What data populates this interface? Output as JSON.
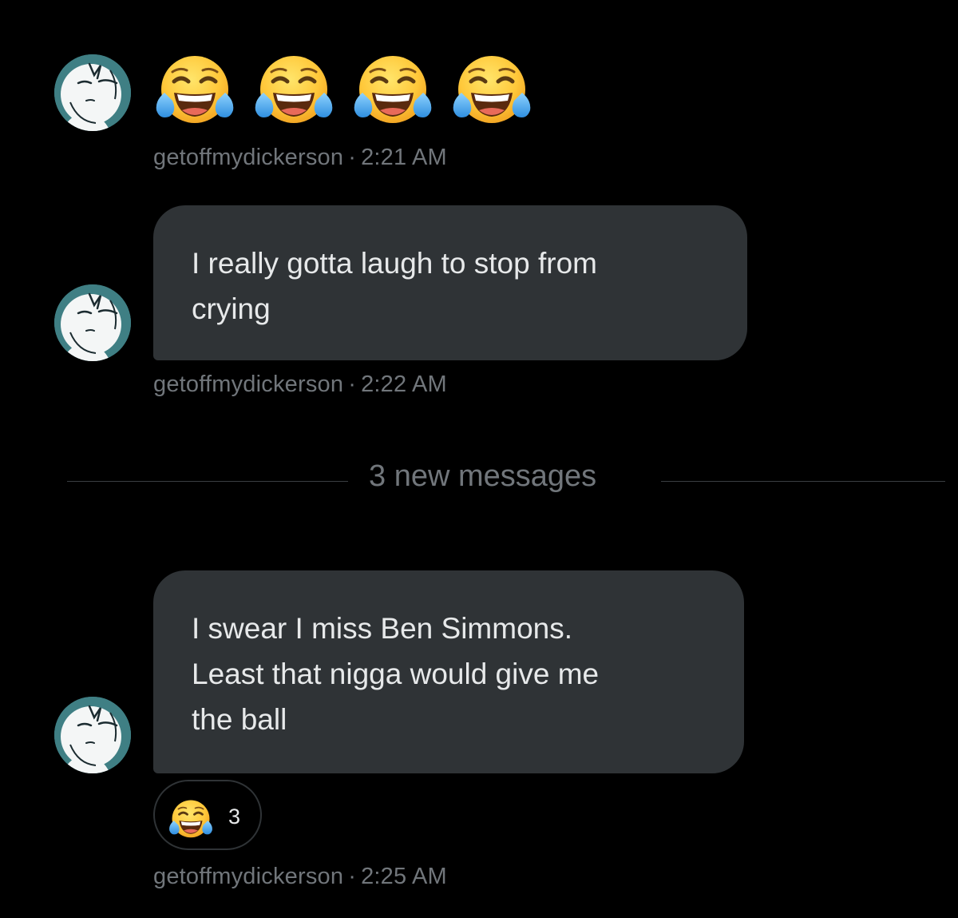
{
  "colors": {
    "background": "#000000",
    "bubble": "#2f3336",
    "meta_text": "#71767b",
    "message_text": "#e7e9ea",
    "avatar_bg": "#3f7f84"
  },
  "icons": {
    "emoji": "face-with-tears-of-joy-icon",
    "avatar": "profile-avatar"
  },
  "messages": [
    {
      "emojis": [
        "😂",
        "😂",
        "😂",
        "😂"
      ],
      "username": "getoffmydickerson",
      "separator": "·",
      "time": "2:21 AM"
    },
    {
      "lines": [
        "I really gotta laugh to stop from",
        "crying"
      ],
      "username": "getoffmydickerson",
      "separator": "·",
      "time": "2:22 AM"
    },
    {
      "lines": [
        "I swear I miss Ben Simmons.",
        "Least that nigga would give me",
        "the ball"
      ],
      "username": "getoffmydickerson",
      "separator": "·",
      "time": "2:25 AM",
      "reaction": {
        "emoji": "😂",
        "count": "3"
      }
    }
  ],
  "divider": {
    "label": "3 new messages"
  }
}
